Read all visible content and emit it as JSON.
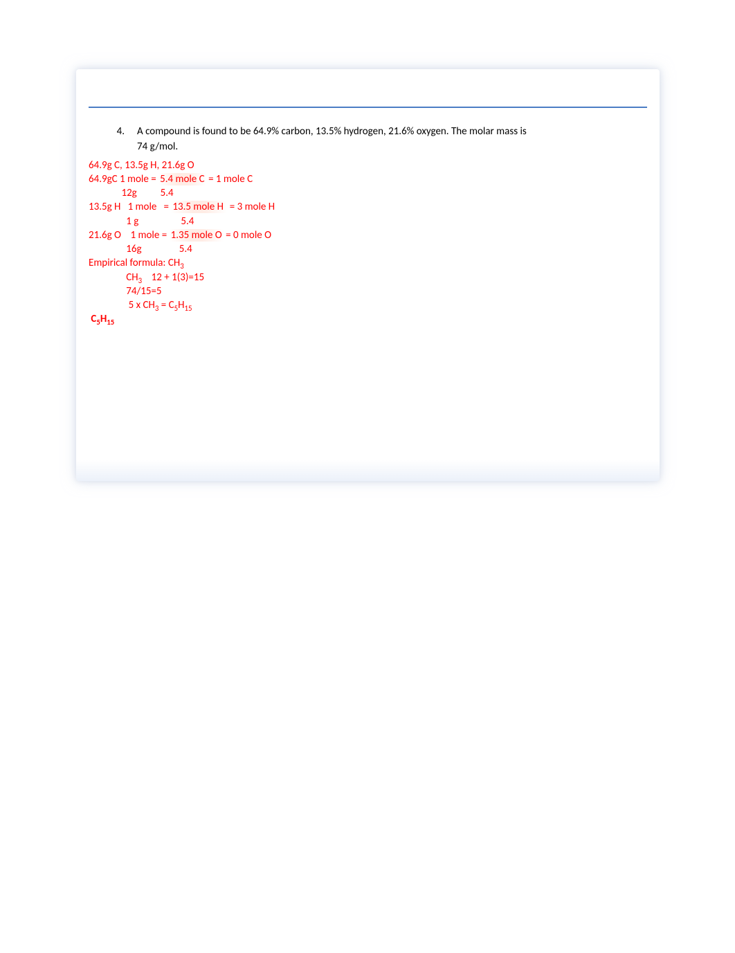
{
  "question": {
    "number": "4.",
    "text_line1": "A compound is found to be 64.9% carbon, 13.5% hydrogen, 21.6% oxygen.   The molar mass is",
    "text_line2": "74 g/mol."
  },
  "work": {
    "l1": "64.9g C, 13.5g H, 21.6g O",
    "l2_a": "64.9gC 1 mole = ",
    "l2_b": "5.4 mole C",
    "l2_c": " = 1 mole C",
    "l3": "              12g          5.4",
    "l4_a": "13.5g H   1 mole   = ",
    "l4_b": "13.5 mole H ",
    "l4_c": " = 3 mole H",
    "l5": "                1 g                  5.4",
    "l6_a": "21.6g O    1 mole = ",
    "l6_b": "1.35 mole O",
    "l6_c": " = 0 mole O",
    "l7": "                16g                5.4",
    "l8_a": "Empirical formula: CH",
    "l8_sub": "3",
    "l9_a": "                CH",
    "l9_sub": "3",
    "l9_b": "    12 + 1(3)=15",
    "l10": "                74/15=5",
    "l11_a": "                 5 x CH",
    "l11_sub1": "3",
    "l11_b": " = C",
    "l11_sub2": "5",
    "l11_c": "H",
    "l11_sub3": "15",
    "ans_a": " C",
    "ans_sub1": "5",
    "ans_b": "H",
    "ans_sub2": "15"
  }
}
